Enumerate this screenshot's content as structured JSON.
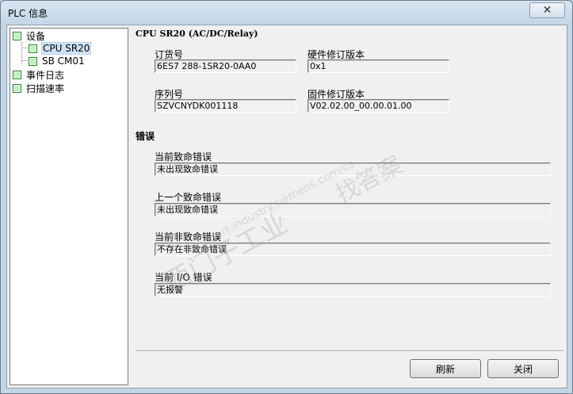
{
  "window": {
    "title": "PLC 信息"
  },
  "tree": {
    "items": [
      {
        "label": "设备"
      },
      {
        "label": "CPU SR20"
      },
      {
        "label": "SB CM01"
      },
      {
        "label": "事件日志"
      },
      {
        "label": "扫描速率"
      }
    ]
  },
  "device": {
    "heading": "CPU SR20 (AC/DC/Relay)",
    "order_label": "订货号",
    "order_value": "6ES7 288-1SR20-0AA0",
    "hw_label": "硬件修订版本",
    "hw_value": "0x1",
    "serial_label": "序列号",
    "serial_value": "SZVCNYDK001118",
    "fw_label": "固件修订版本",
    "fw_value": "V02.02.00_00.00.01.00"
  },
  "errors": {
    "heading": "错误",
    "current_fatal_label": "当前致命错误",
    "current_fatal_value": "未出现致命错误",
    "last_fatal_label": "上一个致命错误",
    "last_fatal_value": "未出现致命错误",
    "current_nonfatal_label": "当前非致命错误",
    "current_nonfatal_value": "不存在非致命错误",
    "current_io_label": "当前 I/O 错误",
    "current_io_value": "无报警"
  },
  "buttons": {
    "refresh": "刷新",
    "close": "关闭"
  },
  "watermark": {
    "line1": "西门子工业",
    "line2": "support.industry.siemens.com/cs",
    "line3": "找答案"
  },
  "icons": {
    "close": "close-icon",
    "tree_node": "tree-node-icon"
  },
  "colors": {
    "tree_node_fill": "#bff0bf",
    "tree_node_border": "#2f7a2f"
  }
}
